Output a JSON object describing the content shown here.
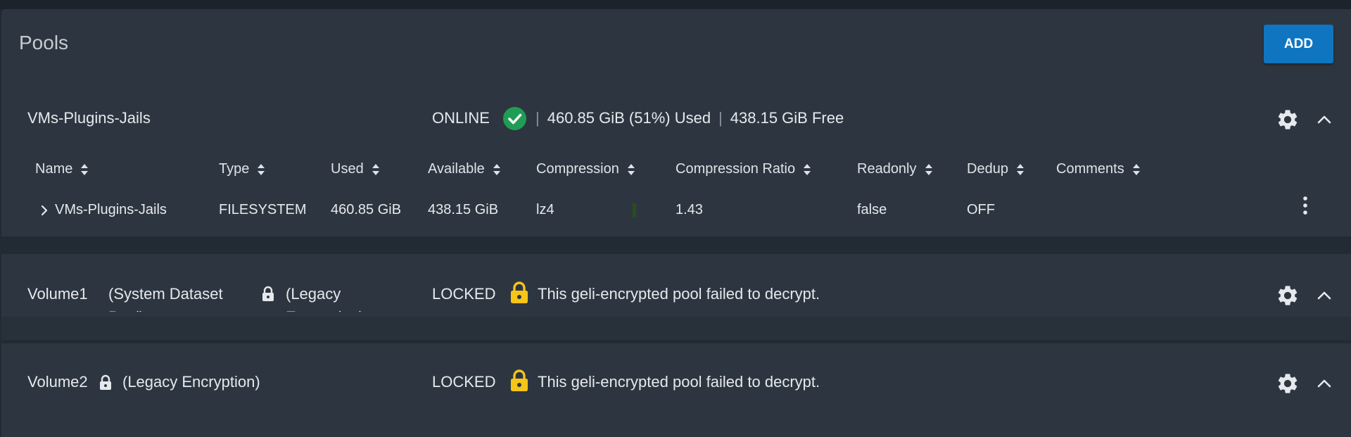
{
  "header": {
    "title": "Pools",
    "add_label": "ADD"
  },
  "pools": [
    {
      "name": "VMs-Plugins-Jails",
      "status": "ONLINE",
      "used": "460.85 GiB (51%) Used",
      "free": "438.15 GiB Free",
      "status_color": "#1f9d55",
      "columns": [
        "Name",
        "Type",
        "Used",
        "Available",
        "Compression",
        "Compression Ratio",
        "Readonly",
        "Dedup",
        "Comments"
      ],
      "rows": [
        {
          "name": "VMs-Plugins-Jails",
          "type": "FILESYSTEM",
          "used": "460.85 GiB",
          "available": "438.15 GiB",
          "compression": "lz4",
          "compression_ratio": "1.43",
          "readonly": "false",
          "dedup": "OFF",
          "comments": ""
        }
      ]
    },
    {
      "name": "Volume1",
      "system_dataset": "(System Dataset Pool)",
      "legacy": "(Legacy Encryption)",
      "status": "LOCKED",
      "message": "This geli-encrypted pool failed to decrypt.",
      "lock_color": "#f5c518"
    },
    {
      "name": "Volume2",
      "legacy": "(Legacy Encryption)",
      "status": "LOCKED",
      "message": "This geli-encrypted pool failed to decrypt.",
      "lock_color": "#f5c518"
    }
  ],
  "icons": {
    "settings": "gear-icon",
    "collapse": "chevron-up-icon",
    "online": "check-circle-icon",
    "locked": "lock-icon",
    "expand": "chevron-right-icon",
    "menu": "more-vertical-icon",
    "sort": "sort-icon"
  }
}
